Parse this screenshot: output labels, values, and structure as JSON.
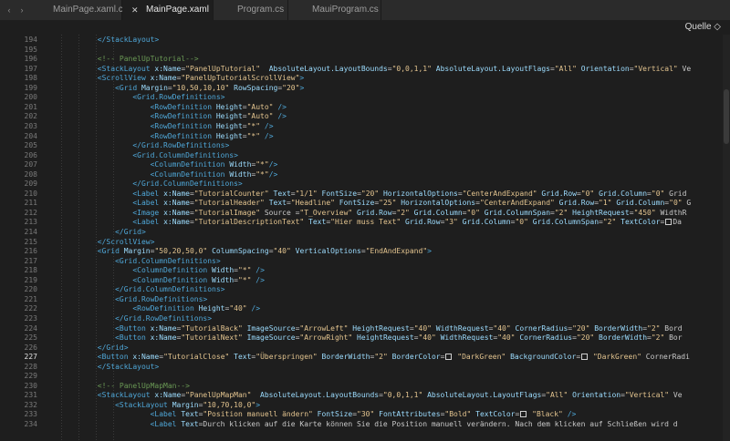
{
  "tabs": [
    {
      "label": "MainPage.xaml.cs",
      "active": false
    },
    {
      "label": "MainPage.xaml",
      "active": true
    },
    {
      "label": "Program.cs",
      "active": false
    },
    {
      "label": "MauiProgram.cs",
      "active": false
    }
  ],
  "icons": {
    "nav_back": "chevron-left-icon",
    "nav_forward": "chevron-right-icon",
    "close": "close-icon",
    "dropdown": "chevron-updown-icon"
  },
  "pathbar": {
    "source_label": "Quelle ◇"
  },
  "colors": {
    "tag": "#4fa7d8",
    "attr": "#9cdcfe",
    "string": "#e3c48f",
    "comment": "#6a9955"
  },
  "current_line": "227",
  "editor": {
    "lines": [
      {
        "no": "194",
        "code": "            </StackLayout>"
      },
      {
        "no": "195",
        "code": ""
      },
      {
        "no": "196",
        "code": "            <!-- PanelUpTutorial-->"
      },
      {
        "no": "197",
        "code": "            <StackLayout x:Name=\"PanelUpTutorial\"  AbsoluteLayout.LayoutBounds=\"0,0,1,1\" AbsoluteLayout.LayoutFlags=\"All\" Orientation=\"Vertical\" Ve"
      },
      {
        "no": "198",
        "code": "            <ScrollView x:Name=\"PanelUpTutorialScrollView\">"
      },
      {
        "no": "199",
        "code": "                <Grid Margin=\"10,50,10,10\" RowSpacing=\"20\">"
      },
      {
        "no": "200",
        "code": "                    <Grid.RowDefinitions>"
      },
      {
        "no": "201",
        "code": "                        <RowDefinition Height=\"Auto\" />"
      },
      {
        "no": "202",
        "code": "                        <RowDefinition Height=\"Auto\" />"
      },
      {
        "no": "203",
        "code": "                        <RowDefinition Height=\"*\" />"
      },
      {
        "no": "204",
        "code": "                        <RowDefinition Height=\"*\" />"
      },
      {
        "no": "205",
        "code": "                    </Grid.RowDefinitions>"
      },
      {
        "no": "206",
        "code": "                    <Grid.ColumnDefinitions>"
      },
      {
        "no": "207",
        "code": "                        <ColumnDefinition Width=\"*\"/>"
      },
      {
        "no": "208",
        "code": "                        <ColumnDefinition Width=\"*\"/>"
      },
      {
        "no": "209",
        "code": "                    </Grid.ColumnDefinitions>"
      },
      {
        "no": "210",
        "code": "                    <Label x:Name=\"TutorialCounter\" Text=\"1/1\" FontSize=\"20\" HorizontalOptions=\"CenterAndExpand\" Grid.Row=\"0\" Grid.Column=\"0\" Grid"
      },
      {
        "no": "211",
        "code": "                    <Label x:Name=\"TutorialHeader\" Text=\"Headline\" FontSize=\"25\" HorizontalOptions=\"CenterAndExpand\" Grid.Row=\"1\" Grid.Column=\"0\" G"
      },
      {
        "no": "212",
        "code": "                    <Image x:Name=\"TutorialImage\" Source =\"T_Overview\" Grid.Row=\"2\" Grid.Column=\"0\" Grid.ColumnSpan=\"2\" HeightRequest=\"450\" WidthR"
      },
      {
        "no": "213",
        "code": "                    <Label x:Name=\"TutorialDescriptionText\" Text=\"Hier muss Text\" Grid.Row=\"3\" Grid.Column=\"0\" Grid.ColumnSpan=\"2\" TextColor=▢\"Da"
      },
      {
        "no": "214",
        "code": "                </Grid>"
      },
      {
        "no": "215",
        "code": "            </ScrollView>"
      },
      {
        "no": "216",
        "code": "            <Grid Margin=\"50,20,50,0\" ColumnSpacing=\"40\" VerticalOptions=\"EndAndExpand\">"
      },
      {
        "no": "217",
        "code": "                <Grid.ColumnDefinitions>"
      },
      {
        "no": "218",
        "code": "                    <ColumnDefinition Width=\"*\" />"
      },
      {
        "no": "219",
        "code": "                    <ColumnDefinition Width=\"*\" />"
      },
      {
        "no": "220",
        "code": "                </Grid.ColumnDefinitions>"
      },
      {
        "no": "221",
        "code": "                <Grid.RowDefinitions>"
      },
      {
        "no": "222",
        "code": "                    <RowDefinition Height=\"40\" />"
      },
      {
        "no": "223",
        "code": "                </Grid.RowDefinitions>"
      },
      {
        "no": "224",
        "code": "                <Button x:Name=\"TutorialBack\" ImageSource=\"ArrowLeft\" HeightRequest=\"40\" WidthRequest=\"40\" CornerRadius=\"20\" BorderWidth=\"2\" Bord"
      },
      {
        "no": "225",
        "code": "                <Button x:Name=\"TutorialNext\" ImageSource=\"ArrowRight\" HeightRequest=\"40\" WidthRequest=\"40\" CornerRadius=\"20\" BorderWidth=\"2\" Bor"
      },
      {
        "no": "226",
        "code": "            </Grid>"
      },
      {
        "no": "227",
        "code": "            <Button x:Name=\"TutorialClose\" Text=\"Überspringen\" BorderWidth=\"2\" BorderColor=▢ \"DarkGreen\" BackgroundColor=▢ \"DarkGreen\" CornerRadi"
      },
      {
        "no": "228",
        "code": "            </StackLayout>"
      },
      {
        "no": "229",
        "code": ""
      },
      {
        "no": "230",
        "code": "            <!-- PanelUpMapMan-->"
      },
      {
        "no": "231",
        "code": "            <StackLayout x:Name=\"PanelUpMapMan\"  AbsoluteLayout.LayoutBounds=\"0,0,1,1\" AbsoluteLayout.LayoutFlags=\"All\" Orientation=\"Vertical\" Ve"
      },
      {
        "no": "232",
        "code": "                <StackLayout Margin=\"10,70,10,0\">"
      },
      {
        "no": "233",
        "code": "                        <Label Text=\"Position manuell ändern\" FontSize=\"30\" FontAttributes=\"Bold\" TextColor=▢ \"Black\" />"
      },
      {
        "no": "234",
        "code": "                        <Label Text=\"Durch klicken auf die Karte können Sie die Position manuell verändern. Nach dem klicken auf Schließen wird d"
      }
    ]
  }
}
